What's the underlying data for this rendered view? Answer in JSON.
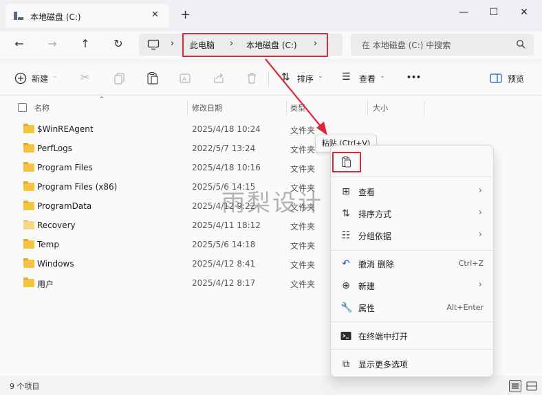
{
  "window": {
    "tab_title": "本地磁盘 (C:)",
    "close_tab": "✕",
    "new_tab": "+",
    "minimize": "—",
    "maximize": "☐",
    "close": "✕"
  },
  "nav": {
    "back": "←",
    "forward": "→",
    "up": "↑",
    "refresh": "↻",
    "breadcrumb": [
      "此电脑",
      "本地磁盘 (C:)"
    ],
    "sep": "›",
    "search_placeholder": "在 本地磁盘 (C:) 中搜索"
  },
  "toolbar": {
    "new_label": "新建",
    "sort_label": "排序",
    "view_label": "查看",
    "more": "•••",
    "preview_label": "预览"
  },
  "list": {
    "columns": [
      "名称",
      "修改日期",
      "类型",
      "大小"
    ],
    "rows": [
      {
        "name": "$WinREAgent",
        "date": "2025/4/18 10:24",
        "type": "文件夹"
      },
      {
        "name": "PerfLogs",
        "date": "2022/5/7 13:24",
        "type": "文件夹"
      },
      {
        "name": "Program Files",
        "date": "2025/4/18 10:16",
        "type": "文件夹"
      },
      {
        "name": "Program Files (x86)",
        "date": "2025/5/6 14:15",
        "type": "文件夹"
      },
      {
        "name": "ProgramData",
        "date": "2025/4/12 9:22",
        "type": "文件夹"
      },
      {
        "name": "Recovery",
        "date": "2025/4/11 18:12",
        "type": "文件夹"
      },
      {
        "name": "Temp",
        "date": "2025/5/6 14:18",
        "type": "文件夹"
      },
      {
        "name": "Windows",
        "date": "2025/4/12 8:41",
        "type": "文件夹"
      },
      {
        "name": "用户",
        "date": "2025/4/12 8:17",
        "type": "文件夹"
      }
    ]
  },
  "status": {
    "count": "9 个项目"
  },
  "tooltip": "粘贴 (Ctrl+V)",
  "context_menu": {
    "items": [
      {
        "label": "查看",
        "shortcut": "",
        "arrow": "›"
      },
      {
        "label": "排序方式",
        "shortcut": "",
        "arrow": "›"
      },
      {
        "label": "分组依据",
        "shortcut": "",
        "arrow": "›"
      },
      {
        "label": "撤消 删除",
        "shortcut": "Ctrl+Z",
        "arrow": ""
      },
      {
        "label": "新建",
        "shortcut": "",
        "arrow": "›"
      },
      {
        "label": "属性",
        "shortcut": "Alt+Enter",
        "arrow": ""
      },
      {
        "label": "在终端中打开",
        "shortcut": "",
        "arrow": ""
      },
      {
        "label": "显示更多选项",
        "shortcut": "",
        "arrow": ""
      }
    ]
  },
  "watermark": "雨梨设计",
  "colors": {
    "highlight": "#e0263a",
    "folder": "#f5c242",
    "accent": "#0a64c8"
  }
}
